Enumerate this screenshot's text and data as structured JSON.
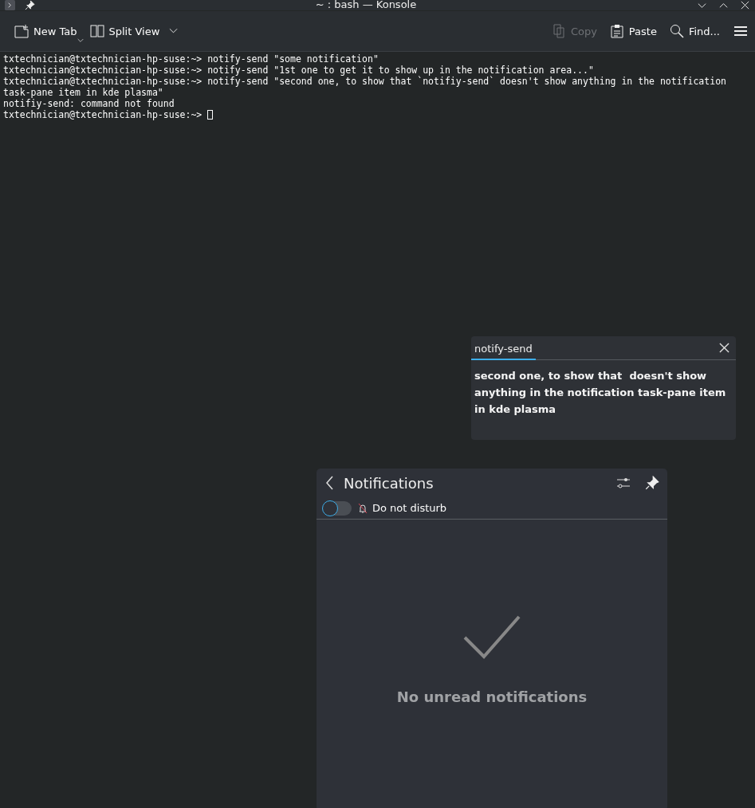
{
  "window": {
    "title": "~ : bash — Konsole"
  },
  "toolbar": {
    "left": [
      {
        "label": "New Tab",
        "disabled": false,
        "menu": true
      },
      {
        "label": "Split View",
        "disabled": false,
        "menu": true
      }
    ],
    "right": [
      {
        "label": "Copy",
        "disabled": true,
        "menu": false
      },
      {
        "label": "Paste",
        "disabled": false,
        "menu": false
      },
      {
        "label": "Find...",
        "disabled": false,
        "menu": false
      }
    ]
  },
  "terminal": {
    "lines": [
      "txtechnician@txtechnician-hp-suse:~> notify-send \"some notification\"",
      "txtechnician@txtechnician-hp-suse:~> notify-send \"1st one to get it to show up in the notification area...\"",
      "txtechnician@txtechnician-hp-suse:~> notify-send \"second one, to show that `notifiy-send` doesn't show anything in the notification",
      "task-pane item in kde plasma\"",
      "notifiy-send: command not found",
      "txtechnician@txtechnician-hp-suse:~> "
    ],
    "cursor": true
  },
  "popup": {
    "app": "notify-send",
    "body": "second one, to show that  doesn't show anything in the notification task-pane item in kde plasma"
  },
  "notifications": {
    "title": "Notifications",
    "do_not_disturb": {
      "label": "Do not disturb",
      "on": false
    },
    "empty_message": "No unread notifications"
  }
}
